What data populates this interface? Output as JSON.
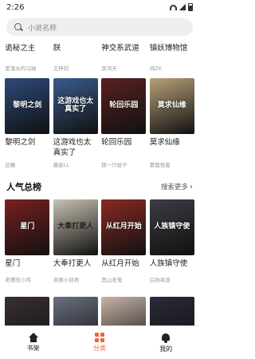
{
  "status_bar": {
    "time": "2:26"
  },
  "search": {
    "placeholder": "小说名称"
  },
  "top_row": {
    "titles": [
      "诡秘之主",
      "朕",
      "神交系武道",
      "镇妖博物馆"
    ],
    "authors": [
      "爱潜水的乌贼",
      "王梓钧",
      "李鸿天",
      "阎ZK"
    ]
  },
  "grid1": [
    {
      "title": "黎明之剑",
      "author": "远瞳",
      "cover_text": "黎明之剑",
      "bg": "#2d4a7a"
    },
    {
      "title": "这游戏也太真实了",
      "author": "晨星LL",
      "cover_text": "这游戏也太真实了",
      "bg": "#3a5b8c"
    },
    {
      "title": "轮回乐园",
      "author": "那一只蚊子",
      "cover_text": "轮回乐园",
      "bg": "#5a2020"
    },
    {
      "title": "莫求仙缘",
      "author": "蒙面怪客",
      "cover_text": "莫求仙缘",
      "bg": "#b8a07a"
    }
  ],
  "section": {
    "title": "人气总榜",
    "more": "搜索更多"
  },
  "grid2": [
    {
      "title": "星门",
      "author": "老鹰吃小鸡",
      "cover_text": "星门",
      "bg": "#7a1f1f"
    },
    {
      "title": "大奉打更人",
      "author": "卖报小郎君",
      "cover_text": "大奉打更人",
      "bg": "#c9c2b2"
    },
    {
      "title": "从红月开始",
      "author": "黑山老鬼",
      "cover_text": "从红月开始",
      "bg": "#8a2a22"
    },
    {
      "title": "人族镇守使",
      "author": "白驹易逝",
      "cover_text": "人族镇守使",
      "bg": "#3c3c44"
    }
  ],
  "grid3": [
    {
      "bg": "#3a3030"
    },
    {
      "bg": "#6a7080"
    },
    {
      "bg": "#c8b4a8"
    },
    {
      "bg": "#2a2a3a"
    }
  ],
  "nav": [
    {
      "label": "书架"
    },
    {
      "label": "分类"
    },
    {
      "label": "我的"
    }
  ],
  "colors": {
    "accent": "#e8663d"
  }
}
